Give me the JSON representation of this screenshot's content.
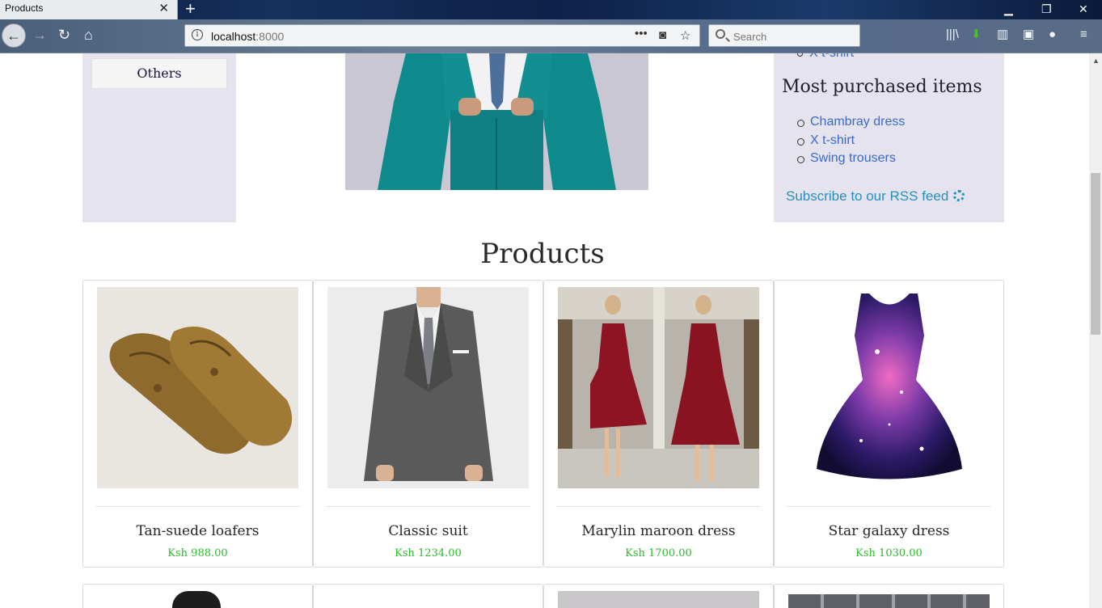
{
  "browser": {
    "tab_title": "Products",
    "url_host": "localhost",
    "url_port": ":8000",
    "search_placeholder": "Search"
  },
  "sidebar": {
    "category_button": "Others"
  },
  "right_sidebar": {
    "partial_item": "X t-shirt",
    "title": "Most purchased items",
    "items": [
      "Chambray dress",
      "X t-shirt",
      "Swing trousers"
    ],
    "rss_label": "Subscribe to our RSS feed"
  },
  "products_heading": "Products",
  "products": [
    {
      "name": "Tan-suede loafers",
      "price": "Ksh 988.00"
    },
    {
      "name": "Classic suit",
      "price": "Ksh 1234.00"
    },
    {
      "name": "Marylin maroon dress",
      "price": "Ksh 1700.00"
    },
    {
      "name": "Star galaxy dress",
      "price": "Ksh 1030.00"
    }
  ],
  "colors": {
    "link": "#3b6ac9",
    "price": "#2bbb2b",
    "sidebar_bg": "#e4e3ee",
    "rss": "#2a8fbd"
  }
}
